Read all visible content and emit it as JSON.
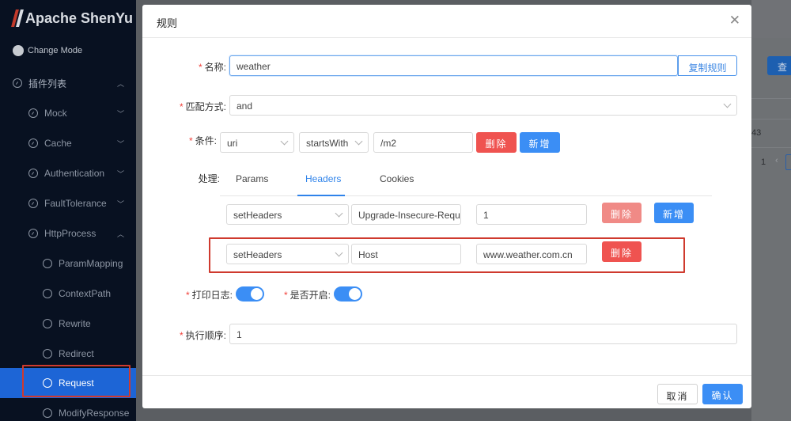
{
  "sidebar": {
    "logo": "Apache ShenYu",
    "change_mode": "Change Mode",
    "plugin_list": "插件列表",
    "items": [
      {
        "label": "Mock"
      },
      {
        "label": "Cache"
      },
      {
        "label": "Authentication"
      },
      {
        "label": "FaultTolerance"
      },
      {
        "label": "HttpProcess"
      }
    ],
    "sub_items": [
      {
        "label": "ParamMapping"
      },
      {
        "label": "ContextPath"
      },
      {
        "label": "Rewrite"
      },
      {
        "label": "Redirect"
      },
      {
        "label": "Request"
      },
      {
        "label": "ModifyResponse"
      }
    ],
    "active_item": "Request"
  },
  "background": {
    "search_btn": "查",
    "cell_value": "43",
    "page_number": "1"
  },
  "modal": {
    "title": "规则",
    "name_label": "名称:",
    "name_value": "weather",
    "copy_rule_btn": "复制规则",
    "match_label": "匹配方式:",
    "match_value": "and",
    "condition_label": "条件:",
    "condition": {
      "param_type": "uri",
      "operator": "startsWith",
      "value": "/m2",
      "delete_btn": "删除",
      "add_btn": "新增"
    },
    "handle_label": "处理:",
    "tabs": [
      "Params",
      "Headers",
      "Cookies"
    ],
    "active_tab": "Headers",
    "header_rows": [
      {
        "type": "setHeaders",
        "key": "Upgrade-Insecure-Requ",
        "value": "1",
        "delete_btn": "删除",
        "add_btn": "新增"
      },
      {
        "type": "setHeaders",
        "key": "Host",
        "value": "www.weather.com.cn",
        "delete_btn": "删除"
      }
    ],
    "log_label": "打印日志:",
    "log_enabled": true,
    "open_label": "是否开启:",
    "open_enabled": true,
    "order_label": "执行顺序:",
    "order_value": "1",
    "cancel_btn": "取消",
    "confirm_btn": "确认"
  },
  "colors": {
    "primary": "#3b8ef5",
    "danger": "#ef5350",
    "highlight_box": "#cf3a2e",
    "sidebar_bg": "#081121"
  }
}
